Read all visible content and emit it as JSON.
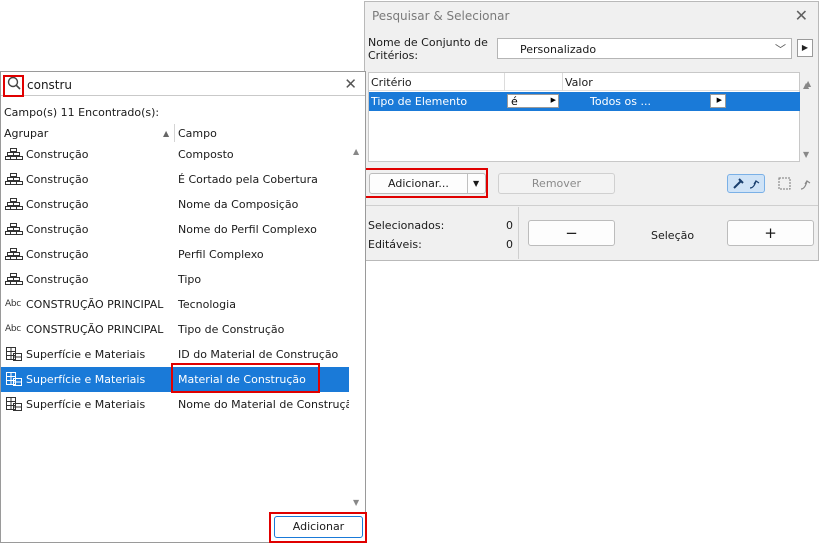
{
  "dialog": {
    "title": "Pesquisar & Selecionar",
    "criteria_set_label": "Nome de Conjunto de Critérios:",
    "criteria_set_value": "Personalizado",
    "table": {
      "col_criterion": "Critério",
      "col_value": "Valor",
      "row": {
        "criterion": "Tipo de Elemento",
        "operator": "é",
        "value": "Todos os ..."
      }
    },
    "add_button": "Adicionar...",
    "remove_button": "Remover",
    "selected_label": "Selecionados:",
    "selected_count": "0",
    "editable_label": "Editáveis:",
    "editable_count": "0",
    "minus_label": "−",
    "selection_label": "Seleção",
    "plus_label": "+"
  },
  "picker": {
    "search_query": "constru",
    "found_text": "Campo(s) 11 Encontrado(s):",
    "col_group": "Agrupar",
    "col_field": "Campo",
    "rows": [
      {
        "icon": "construction-icon",
        "group": "Construção",
        "field": "Composto"
      },
      {
        "icon": "construction-icon",
        "group": "Construção",
        "field": "É Cortado pela Cobertura"
      },
      {
        "icon": "construction-icon",
        "group": "Construção",
        "field": "Nome da Composição"
      },
      {
        "icon": "construction-icon",
        "group": "Construção",
        "field": "Nome do Perfil Complexo"
      },
      {
        "icon": "construction-icon",
        "group": "Construção",
        "field": "Perfil Complexo"
      },
      {
        "icon": "construction-icon",
        "group": "Construção",
        "field": "Tipo"
      },
      {
        "icon": "text-abc-icon",
        "group": "CONSTRUÇÃO PRINCIPAL",
        "field": "Tecnologia"
      },
      {
        "icon": "text-abc-icon",
        "group": "CONSTRUÇÃO PRINCIPAL",
        "field": "Tipo de Construção"
      },
      {
        "icon": "surface-materials-icon",
        "group": "Superfície e Materiais",
        "field": "ID do Material de Construção"
      },
      {
        "icon": "surface-materials-icon",
        "group": "Superfície e Materiais",
        "field": "Material de Construção"
      },
      {
        "icon": "surface-materials-icon",
        "group": "Superfície e Materiais",
        "field": "Nome do Material de Construção"
      }
    ],
    "selected_index": 9,
    "add_button": "Adicionar",
    "abc_text": "Abc"
  },
  "colors": {
    "selection": "#1a7ad8",
    "highlight_box": "#e00000"
  }
}
